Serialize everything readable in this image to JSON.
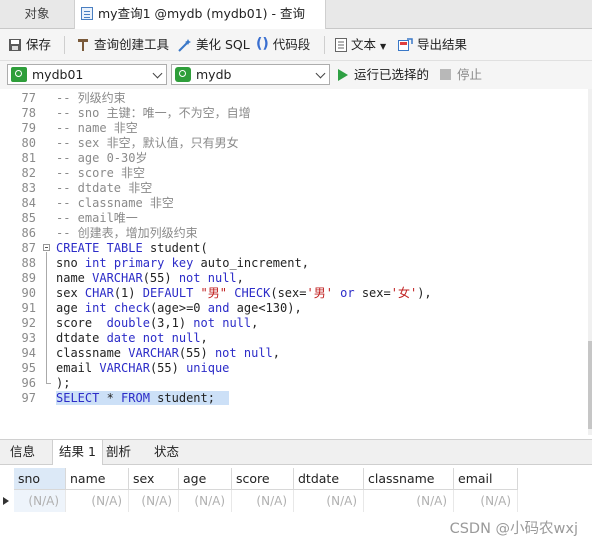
{
  "tabs": {
    "objects": "对象",
    "query": "my查询1 @mydb (mydb01) - 查询"
  },
  "toolbar": {
    "save": "保存",
    "query_builder": "查询创建工具",
    "beautify": "美化 SQL",
    "snippet": "代码段",
    "text": "文本",
    "export": "导出结果"
  },
  "connection": {
    "connection_value": "mydb01",
    "database_value": "mydb",
    "run_selected": "运行已选择的",
    "stop": "停止"
  },
  "editor": {
    "lines": [
      {
        "num": "77",
        "text": "-- 列级约束"
      },
      {
        "num": "78",
        "text": "-- sno 主键：唯一，不为空，自增"
      },
      {
        "num": "79",
        "text": "-- name 非空"
      },
      {
        "num": "80",
        "text": "-- sex 非空，默认值，只有男女"
      },
      {
        "num": "81",
        "text": "-- age 0-30岁"
      },
      {
        "num": "82",
        "text": "-- score 非空"
      },
      {
        "num": "83",
        "text": "-- dtdate 非空"
      },
      {
        "num": "84",
        "text": "-- classname 非空"
      },
      {
        "num": "85",
        "text": "-- email唯一"
      },
      {
        "num": "86",
        "text": "-- 创建表，增加列级约束"
      },
      {
        "num": "87",
        "text": "CREATE TABLE student("
      },
      {
        "num": "88",
        "text": "sno int primary key auto_increment,"
      },
      {
        "num": "89",
        "text": "name VARCHAR(55) not null,"
      },
      {
        "num": "90",
        "text": "sex CHAR(1) DEFAULT \"男\" CHECK(sex='男' or sex='女'),"
      },
      {
        "num": "91",
        "text": "age int check(age>=0 and age<130),"
      },
      {
        "num": "92",
        "text": "score  double(3,1) not null,"
      },
      {
        "num": "93",
        "text": "dtdate date not null,"
      },
      {
        "num": "94",
        "text": "classname VARCHAR(55) not null,"
      },
      {
        "num": "95",
        "text": "email VARCHAR(55) unique"
      },
      {
        "num": "96",
        "text": ");"
      },
      {
        "num": "97",
        "text": "SELECT * FROM student;"
      }
    ]
  },
  "results": {
    "tabs": [
      "信息",
      "结果 1",
      "剖析",
      "状态"
    ],
    "active_tab": "结果 1",
    "columns": [
      "sno",
      "name",
      "sex",
      "age",
      "score",
      "dtdate",
      "classname",
      "email"
    ],
    "row": [
      "(N/A)",
      "(N/A)",
      "(N/A)",
      "(N/A)",
      "(N/A)",
      "(N/A)",
      "(N/A)",
      "(N/A)"
    ]
  },
  "watermark": "CSDN @小码农wxj",
  "colors": {
    "keyword": "#2c2cc8",
    "comment": "#8a8a8a",
    "string": "#c02020",
    "selection": "#cce0f7",
    "run_green": "#2ea043"
  }
}
